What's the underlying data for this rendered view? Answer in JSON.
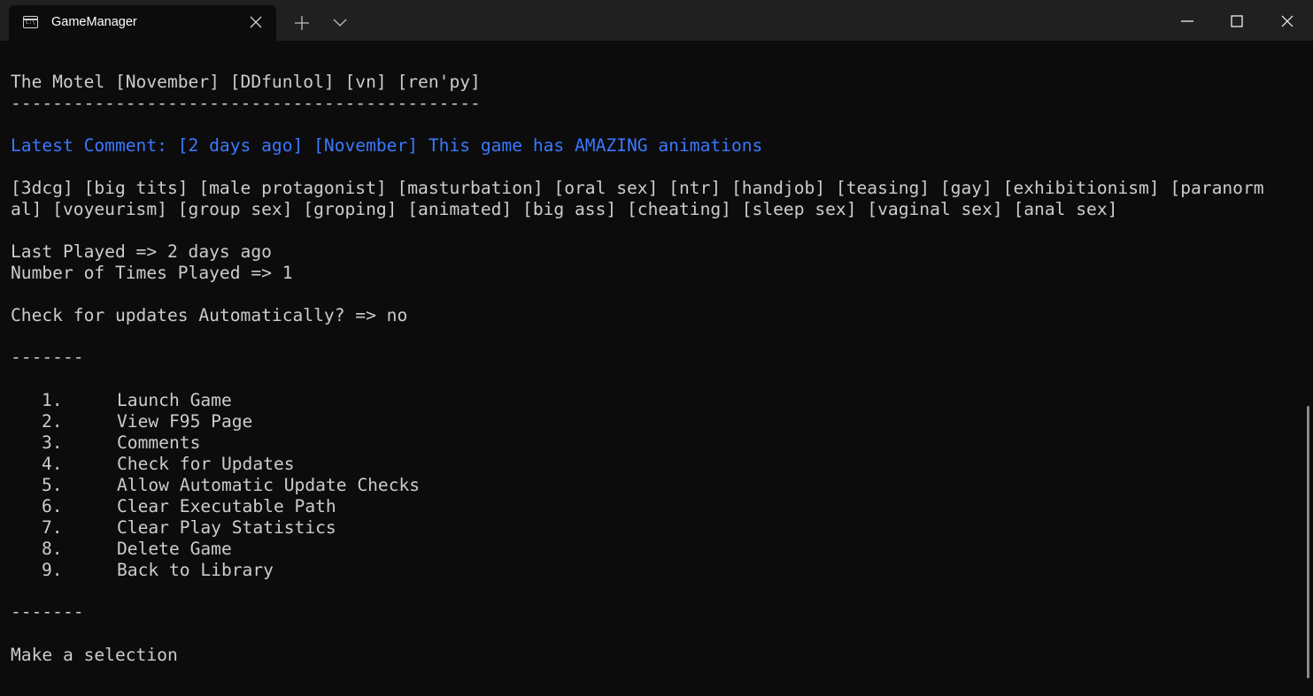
{
  "window": {
    "tab_title": "GameManager",
    "tab_icon": "terminal-icon",
    "tab_icon_text": "C:\\"
  },
  "game": {
    "title_line": "The Motel [November] [DDfunlol] [vn] [ren'py]",
    "underline": "---------------------------------------------",
    "latest_comment": "Latest Comment: [2 days ago] [November] This game has AMAZING animations",
    "tags_line1": "[3dcg] [big tits] [male protagonist] [masturbation] [oral sex] [ntr] [handjob] [teasing] [gay] [exhibitionism] [paranorm",
    "tags_line2": "al] [voyeurism] [group sex] [groping] [animated] [big ass] [cheating] [sleep sex] [vaginal sex] [anal sex]",
    "last_played": "Last Played => 2 days ago",
    "times_played": "Number of Times Played => 1",
    "auto_update": "Check for updates Automatically? => no"
  },
  "separator": "-------",
  "menu": [
    {
      "num": "1.",
      "label": "Launch Game"
    },
    {
      "num": "2.",
      "label": "View F95 Page"
    },
    {
      "num": "3.",
      "label": "Comments"
    },
    {
      "num": "4.",
      "label": "Check for Updates"
    },
    {
      "num": "5.",
      "label": "Allow Automatic Update Checks"
    },
    {
      "num": "6.",
      "label": "Clear Executable Path"
    },
    {
      "num": "7.",
      "label": "Clear Play Statistics"
    },
    {
      "num": "8.",
      "label": "Delete Game"
    },
    {
      "num": "9.",
      "label": "Back to Library"
    }
  ],
  "prompt": "Make a selection",
  "colors": {
    "background": "#0c0c0c",
    "titlebar": "#202020",
    "text": "#cccccc",
    "comment": "#3b78ff"
  }
}
